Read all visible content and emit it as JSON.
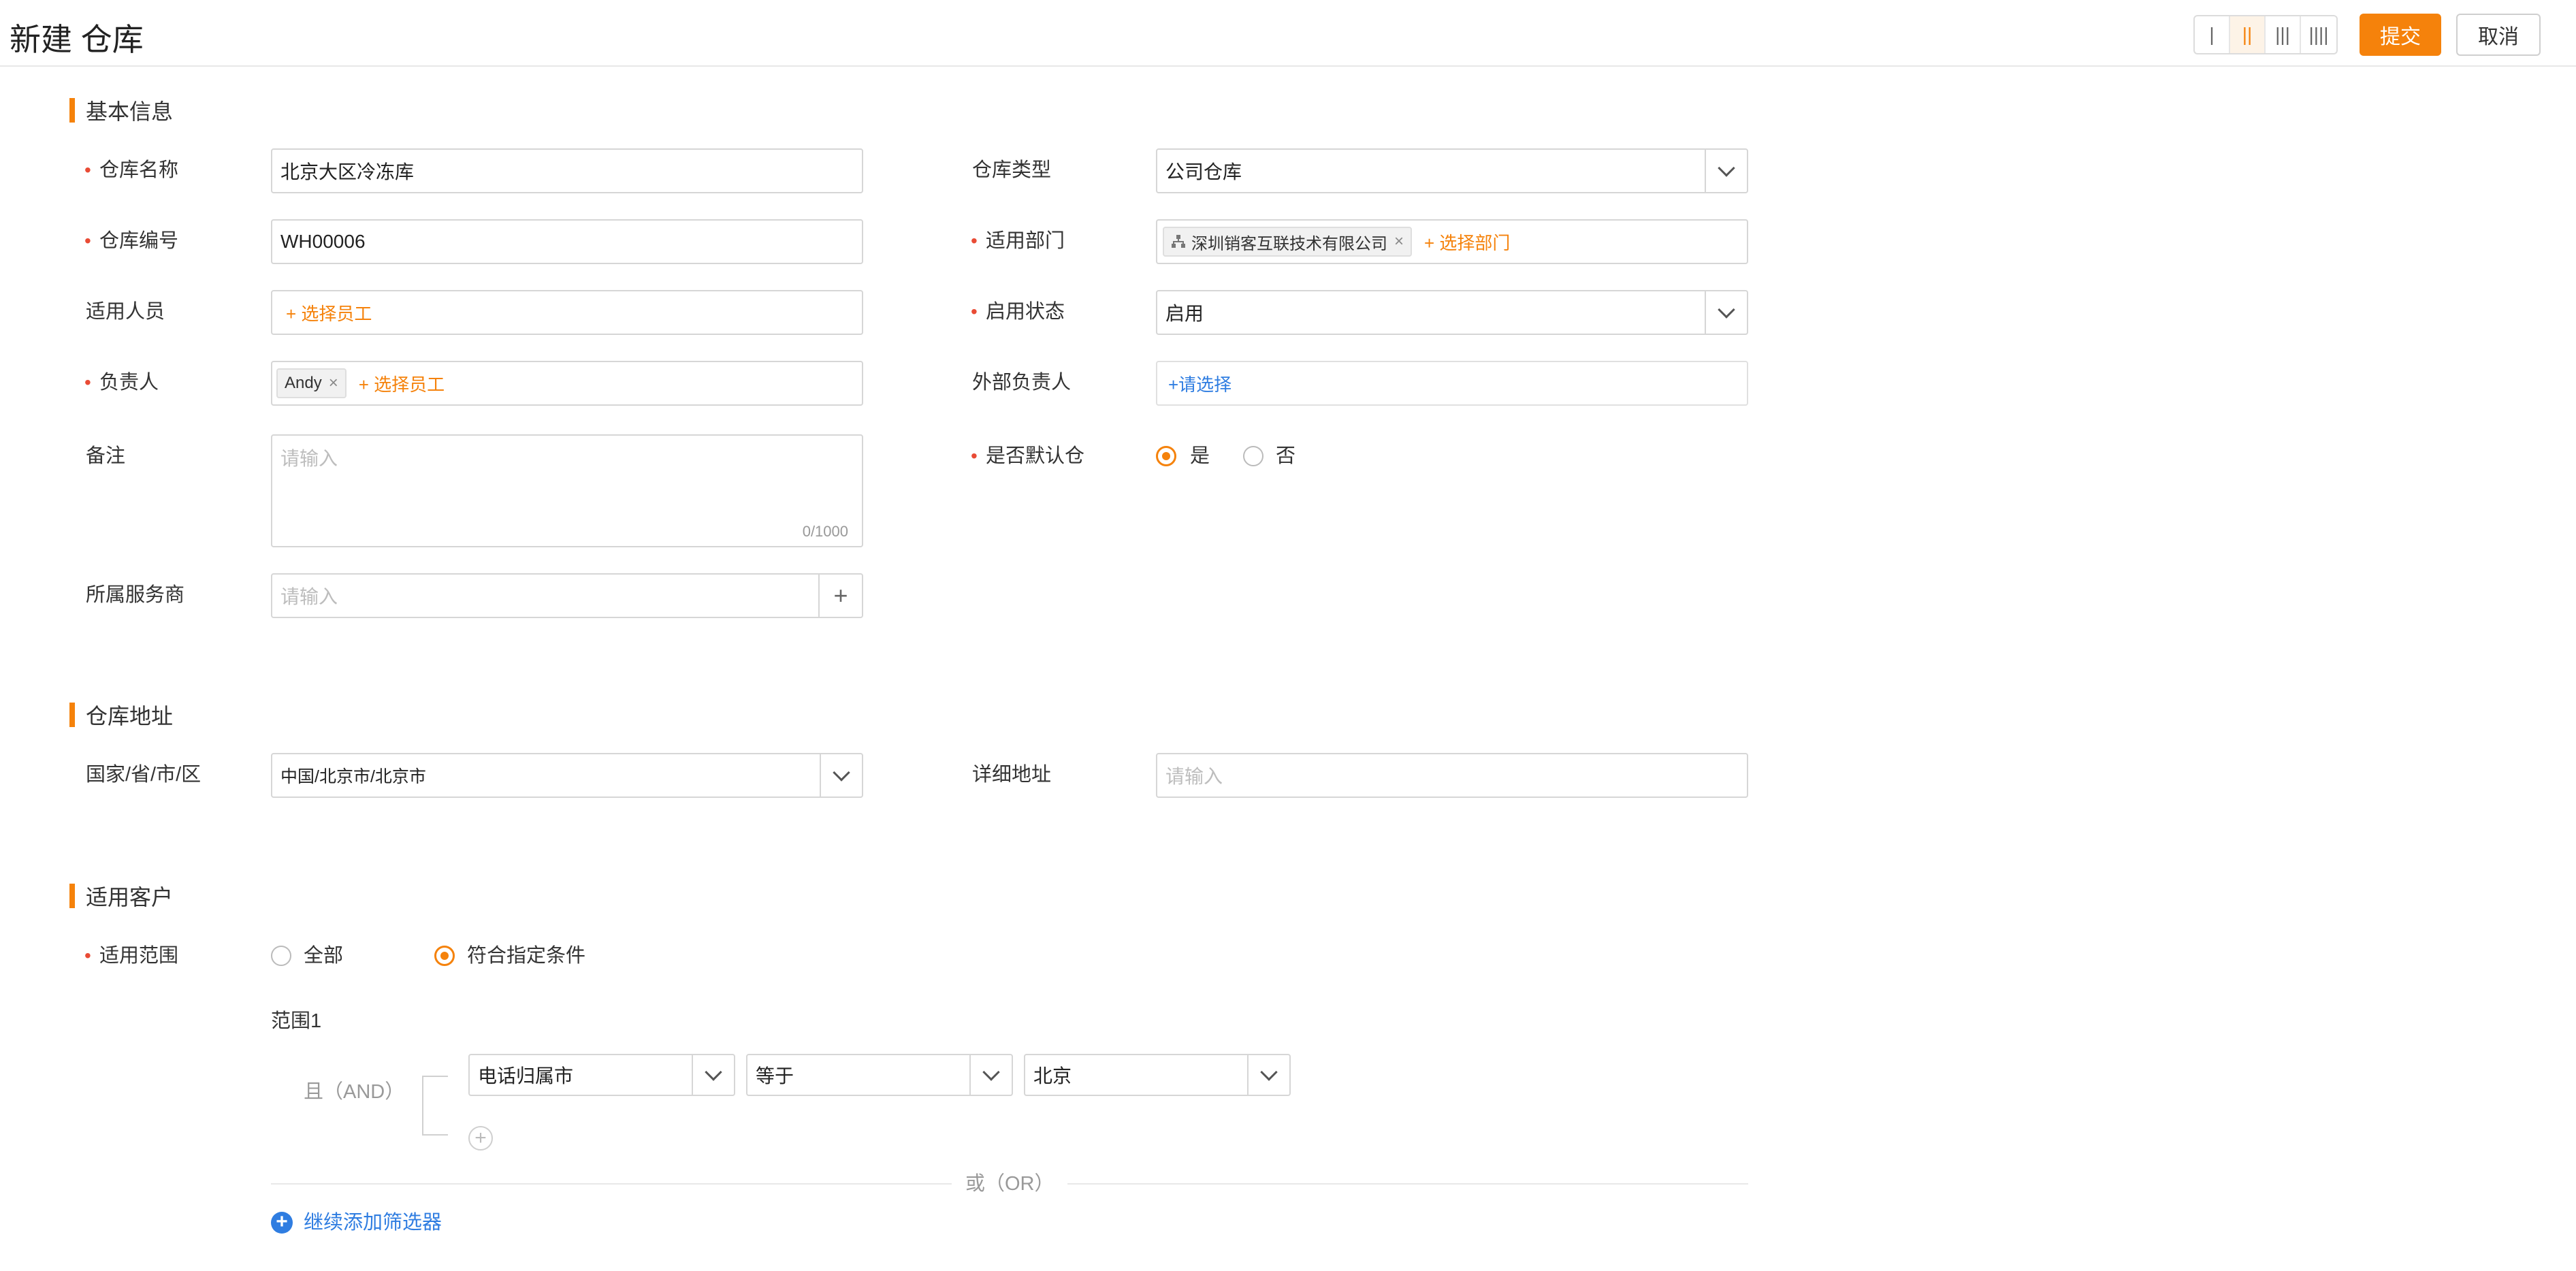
{
  "header": {
    "title": "新建 仓库",
    "layout_options": [
      "|",
      "||",
      "|||",
      "||||"
    ],
    "layout_selected": 1,
    "submit_label": "提交",
    "cancel_label": "取消"
  },
  "sections": {
    "basic": "基本信息",
    "address": "仓库地址",
    "customer": "适用客户"
  },
  "basic": {
    "name": {
      "label": "仓库名称",
      "value": "北京大区冷冻库"
    },
    "type": {
      "label": "仓库类型",
      "value": "公司仓库"
    },
    "code": {
      "label": "仓库编号",
      "value": "WH00006"
    },
    "dept": {
      "label": "适用部门",
      "tag": "深圳销客互联技术有限公司",
      "add": "+ 选择部门"
    },
    "staff": {
      "label": "适用人员",
      "add": "+ 选择员工"
    },
    "status": {
      "label": "启用状态",
      "value": "启用"
    },
    "owner": {
      "label": "负责人",
      "tag": "Andy",
      "add": "+ 选择员工"
    },
    "ext_owner": {
      "label": "外部负责人",
      "add": "+请选择"
    },
    "remark": {
      "label": "备注",
      "placeholder": "请输入",
      "count": "0/1000"
    },
    "default": {
      "label": "是否默认仓",
      "yes": "是",
      "no": "否",
      "selected": "是"
    },
    "provider": {
      "label": "所属服务商",
      "placeholder": "请输入",
      "plus": "+"
    }
  },
  "address": {
    "region": {
      "label": "国家/省/市/区",
      "value": "中国/北京市/北京市"
    },
    "detail": {
      "label": "详细地址",
      "placeholder": "请输入"
    }
  },
  "customer": {
    "scope": {
      "label": "适用范围",
      "all": "全部",
      "cond": "符合指定条件",
      "selected": "符合指定条件"
    },
    "range_title": "范围1",
    "and_label": "且（AND）",
    "filter": {
      "field": "电话归属市",
      "op": "等于",
      "value": "北京"
    },
    "add_condition": "+",
    "or_label": "或（OR）",
    "add_filter": "继续添加筛选器"
  },
  "colors": {
    "accent": "#f5820b",
    "link": "#2f7de1",
    "required": "#e94b35"
  }
}
